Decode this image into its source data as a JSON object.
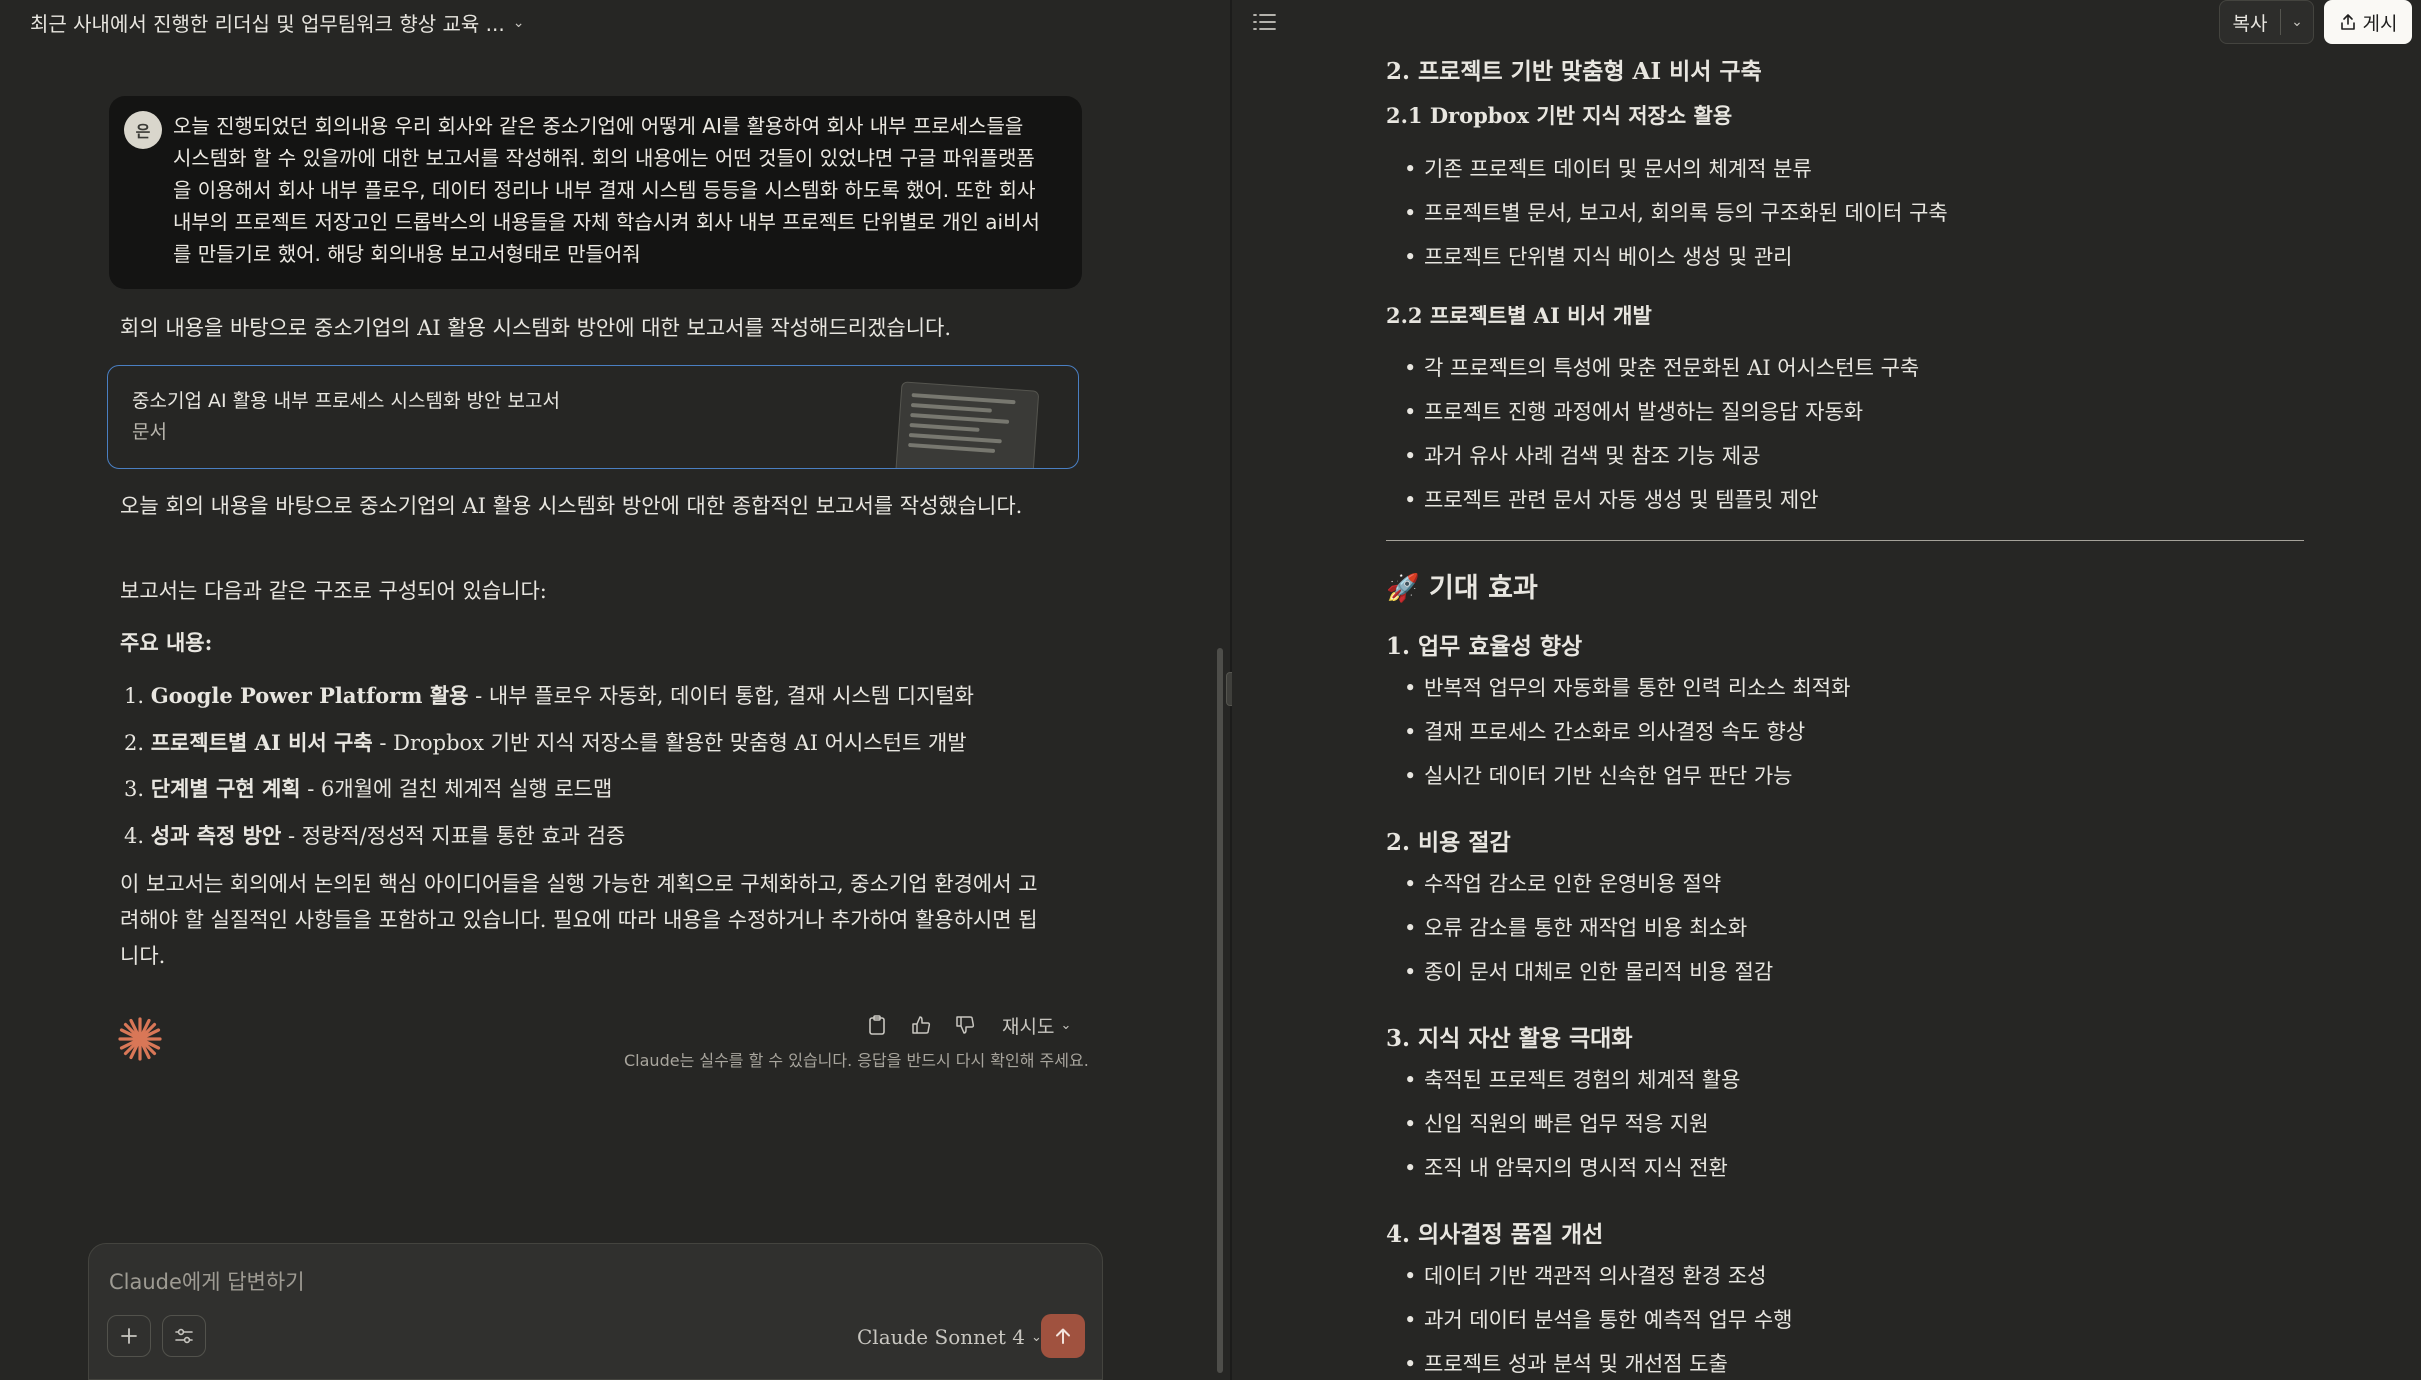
{
  "conversation": {
    "title": "최근 사내에서 진행한 리더십 및 업무팀워크 향상 교육 ...",
    "user_initial": "은",
    "user_message": "오늘 진행되었던 회의내용 우리 회사와 같은 중소기업에 어떻게 AI를 활용하여 회사 내부 프로세스들을 시스템화 할 수 있을까에 대한 보고서를 작성해줘. 회의 내용에는 어떤 것들이 있었냐면 구글 파워플랫폼을 이용해서 회사 내부 플로우, 데이터 정리나 내부 결재 시스템 등등을 시스템화 하도록 했어. 또한 회사 내부의 프로젝트 저장고인 드롭박스의 내용들을 자체 학습시켜 회사 내부 프로젝트 단위별로 개인 ai비서를 만들기로 했어. 해당 회의내용 보고서형태로 만들어줘",
    "assistant_intro": "회의 내용을 바탕으로 중소기업의 AI 활용 시스템화 방안에 대한 보고서를 작성해드리겠습니다.",
    "artifact": {
      "title": "중소기업 AI 활용 내부 프로세스 시스템화 방안 보고서",
      "type_label": "문서"
    },
    "para_after": "오늘 회의 내용을 바탕으로 중소기업의 AI 활용 시스템화 방안에 대한 종합적인 보고서를 작성했습니다.",
    "structure_intro": "보고서는 다음과 같은 구조로 구성되어 있습니다:",
    "main_label": "주요 내용:",
    "list": [
      {
        "num": "1.",
        "bold": "Google Power Platform 활용",
        "rest": " - 내부 플로우 자동화, 데이터 통합, 결재 시스템 디지털화"
      },
      {
        "num": "2.",
        "bold": "프로젝트별 AI 비서 구축",
        "rest": " - Dropbox 기반 지식 저장소를 활용한 맞춤형 AI 어시스턴트 개발"
      },
      {
        "num": "3.",
        "bold": "단계별 구현 계획",
        "rest": " - 6개월에 걸친 체계적 실행 로드맵"
      },
      {
        "num": "4.",
        "bold": "성과 측정 방안",
        "rest": " - 정량적/정성적 지표를 통한 효과 검증"
      }
    ],
    "closing": "이 보고서는 회의에서 논의된 핵심 아이디어들을 실행 가능한 계획으로 구체화하고, 중소기업 환경에서 고려해야 할 실질적인 사항들을 포함하고 있습니다. 필요에 따라 내용을 수정하거나 추가하여 활용하시면 됩니다.",
    "retry_label": "재시도",
    "disclaimer": "Claude는 실수를 할 수 있습니다. 응답을 반드시 다시 확인해 주세요."
  },
  "composer": {
    "placeholder": "Claude에게 답변하기",
    "model": "Claude Sonnet 4"
  },
  "doc_toolbar": {
    "copy_label": "복사",
    "publish_label": "게시"
  },
  "document": {
    "sec2_title": "2. 프로젝트 기반 맞춤형 AI 비서 구축",
    "sec2_1_title": "2.1 Dropbox 기반 지식 저장소 활용",
    "sec2_1_items": [
      "기존 프로젝트 데이터 및 문서의 체계적 분류",
      "프로젝트별 문서, 보고서, 회의록 등의 구조화된 데이터 구축",
      "프로젝트 단위별 지식 베이스 생성 및 관리"
    ],
    "sec2_2_title": "2.2 프로젝트별 AI 비서 개발",
    "sec2_2_items": [
      "각 프로젝트의 특성에 맞춘 전문화된 AI 어시스턴트 구축",
      "프로젝트 진행 과정에서 발생하는 질의응답 자동화",
      "과거 유사 사례 검색 및 참조 기능 제공",
      "프로젝트 관련 문서 자동 생성 및 템플릿 제안"
    ],
    "effects_title": "🚀 기대 효과",
    "e1_title": "1. 업무 효율성 향상",
    "e1_items": [
      "반복적 업무의 자동화를 통한 인력 리소스 최적화",
      "결재 프로세스 간소화로 의사결정 속도 향상",
      "실시간 데이터 기반 신속한 업무 판단 가능"
    ],
    "e2_title": "2. 비용 절감",
    "e2_items": [
      "수작업 감소로 인한 운영비용 절약",
      "오류 감소를 통한 재작업 비용 최소화",
      "종이 문서 대체로 인한 물리적 비용 절감"
    ],
    "e3_title": "3. 지식 자산 활용 극대화",
    "e3_items": [
      "축적된 프로젝트 경험의 체계적 활용",
      "신입 직원의 빠른 업무 적응 지원",
      "조직 내 암묵지의 명시적 지식 전환"
    ],
    "e4_title": "4. 의사결정 품질 개선",
    "e4_items": [
      "데이터 기반 객관적 의사결정 환경 조성",
      "과거 데이터 분석을 통한 예측적 업무 수행",
      "프로젝트 성과 분석 및 개선점 도출"
    ]
  },
  "colors": {
    "background": "#262624",
    "user_bubble": "#141413",
    "artifact_border": "#4a7fc2",
    "accent": "#d97757",
    "send_button": "#a0523f"
  }
}
